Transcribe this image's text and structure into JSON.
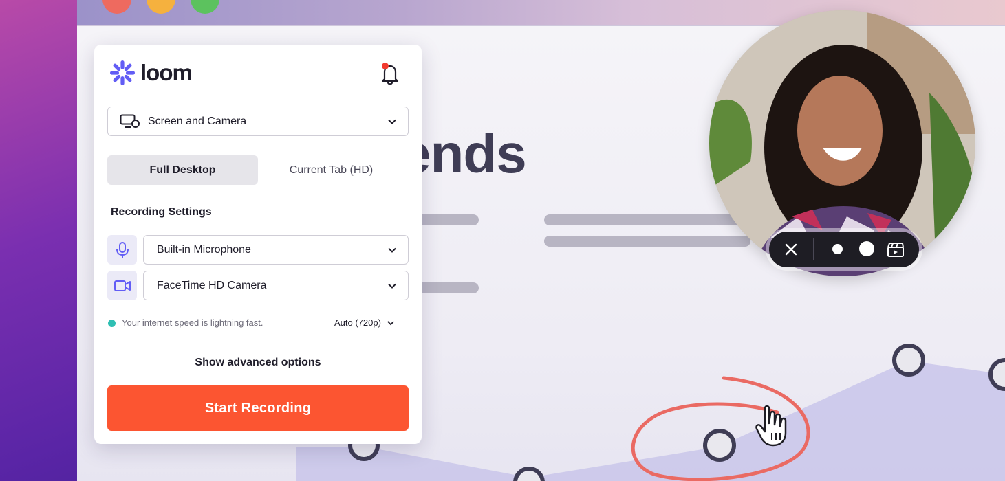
{
  "app": {
    "logo_text": "loom",
    "notification": "bell-icon"
  },
  "recording_mode": {
    "selected": "Screen and Camera"
  },
  "capture_tabs": [
    {
      "label": "Full Desktop",
      "active": true
    },
    {
      "label": "Current Tab (HD)",
      "active": false
    }
  ],
  "settings": {
    "title": "Recording Settings",
    "microphone": "Built-in Microphone",
    "camera": "FaceTime HD Camera"
  },
  "status": {
    "speed_text": "Your internet speed is lightning fast.",
    "quality": "Auto (720p)"
  },
  "advanced_label": "Show advanced options",
  "start_label": "Start Recording",
  "background_page": {
    "heading": "ends"
  },
  "colors": {
    "accent": "#fc5531",
    "brand": "#625df5",
    "status_ok": "#2fbfb3"
  }
}
